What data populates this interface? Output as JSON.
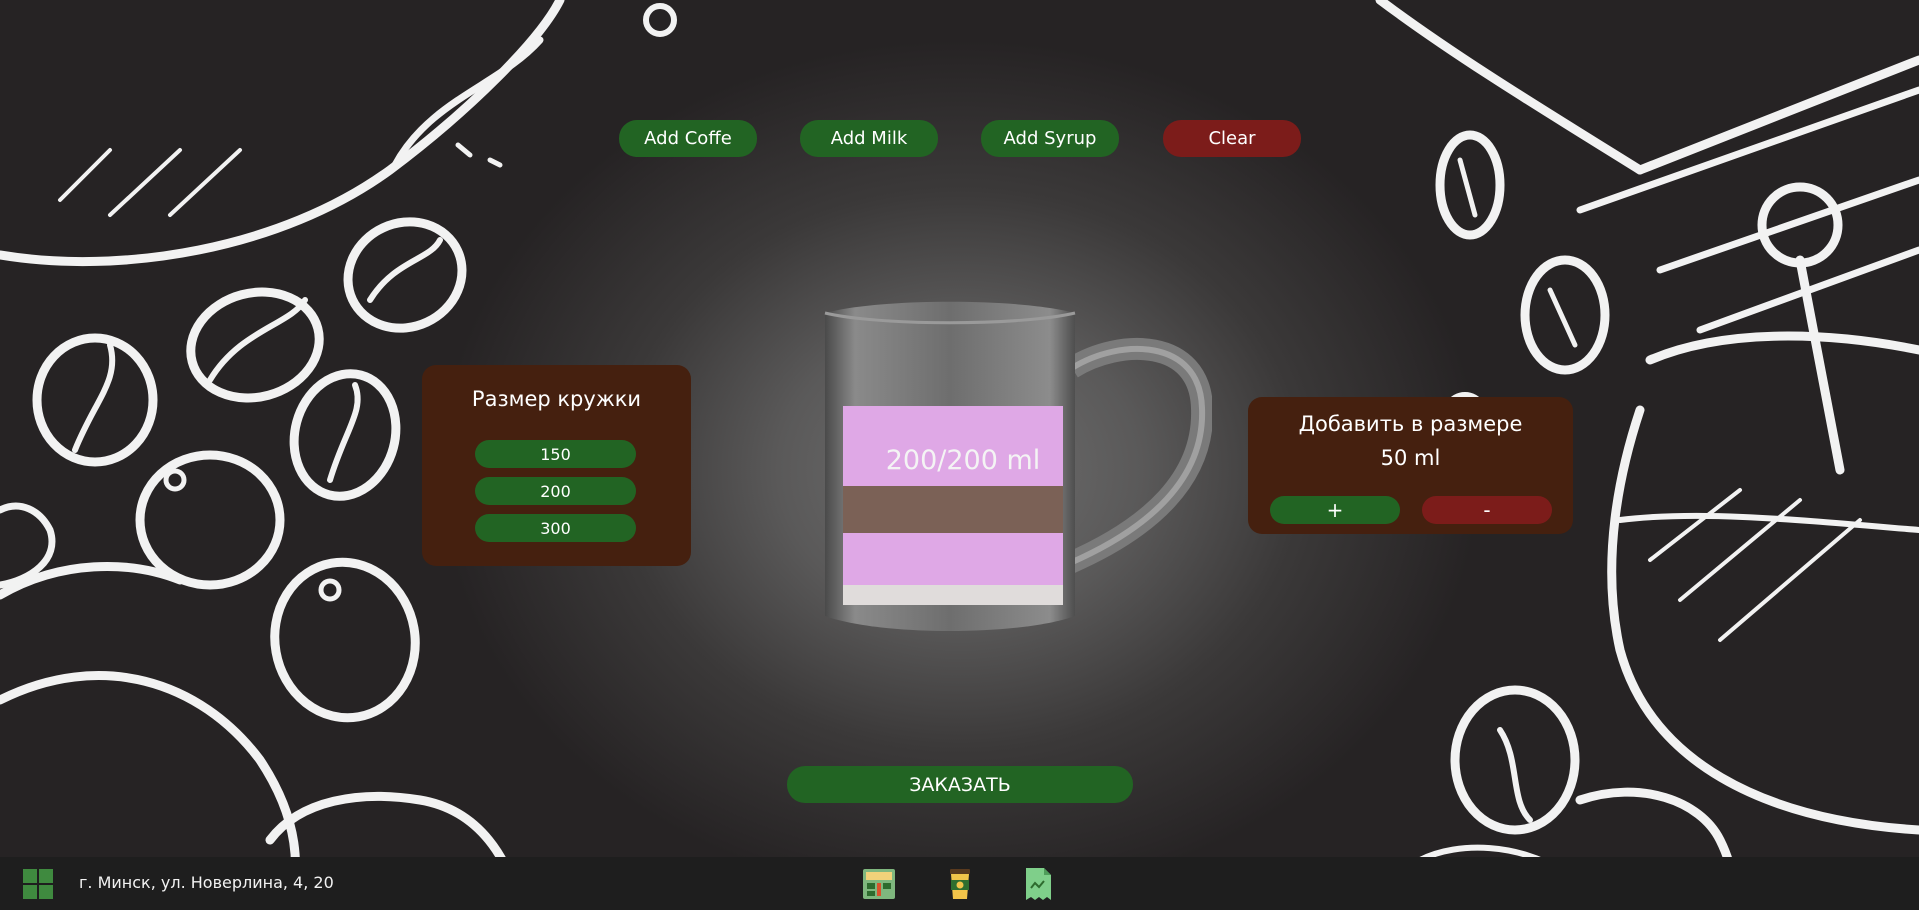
{
  "toolbar": {
    "add_coffee": "Add Coffe",
    "add_milk": "Add Milk",
    "add_syrup": "Add Syrup",
    "clear": "Clear"
  },
  "mug_size_panel": {
    "title": "Размер кружки",
    "options": [
      "150",
      "200",
      "300"
    ]
  },
  "mug": {
    "fill_text": "200/200 ml",
    "layers_bottom_to_top": [
      "milk",
      "syrup",
      "coffee",
      "syrup"
    ]
  },
  "add_amount_panel": {
    "title": "Добавить в размере",
    "amount": "50 ml",
    "plus_label": "+",
    "minus_label": "-"
  },
  "order_button": "ЗАКАЗАТЬ",
  "taskbar": {
    "address": "г. Минск, ул. Новерлина, 4, 20",
    "icons": [
      "windows-start-icon",
      "cash-register-icon",
      "coffee-cup-icon",
      "receipt-icon"
    ]
  },
  "colors": {
    "green": "#226423",
    "red": "#7c1c1a",
    "panel_brown": "#45200f",
    "syrup": "#d9a6e0",
    "coffee": "#7a5e52",
    "milk": "#e2dedd"
  }
}
